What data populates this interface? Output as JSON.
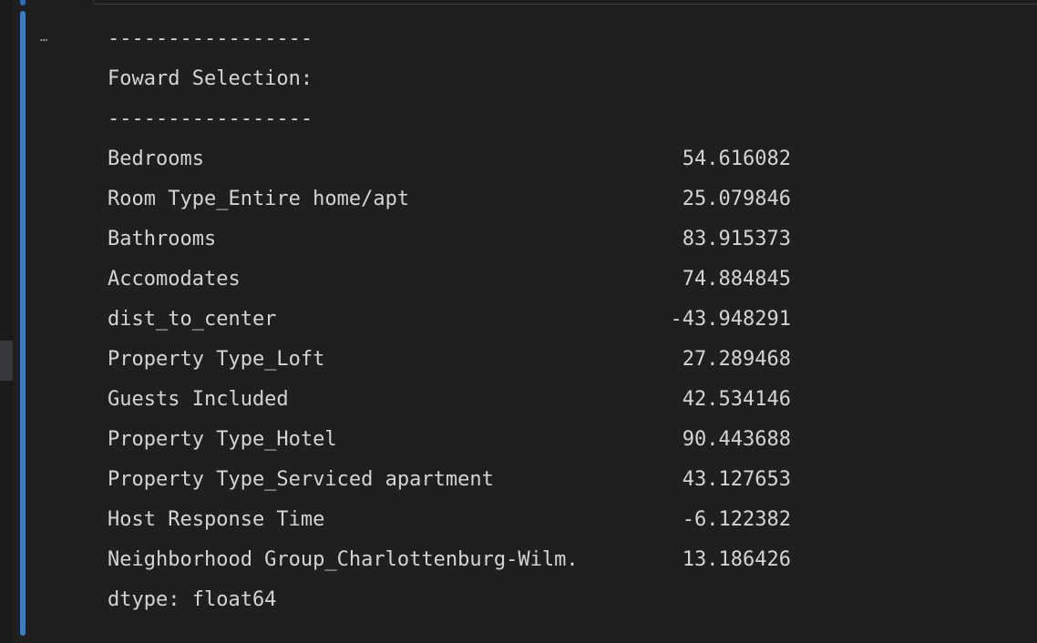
{
  "output": {
    "menu_icon": "…",
    "separator_top": "-----------------",
    "heading": "Foward Selection:",
    "separator_bottom": "-----------------",
    "rows": [
      {
        "name": "Bedrooms",
        "value": "54.616082"
      },
      {
        "name": "Room Type_Entire home/apt",
        "value": "25.079846"
      },
      {
        "name": "Bathrooms",
        "value": "83.915373"
      },
      {
        "name": "Accomodates",
        "value": "74.884845"
      },
      {
        "name": "dist_to_center",
        "value": "-43.948291"
      },
      {
        "name": "Property Type_Loft",
        "value": "27.289468"
      },
      {
        "name": "Guests Included",
        "value": "42.534146"
      },
      {
        "name": "Property Type_Hotel",
        "value": "90.443688"
      },
      {
        "name": "Property Type_Serviced apartment",
        "value": "43.127653"
      },
      {
        "name": "Host Response Time",
        "value": "-6.122382"
      },
      {
        "name": "Neighborhood Group_Charlottenburg-Wilm.",
        "value": "13.186426"
      }
    ],
    "dtype": "dtype: float64"
  },
  "colors": {
    "background": "#1f1f1f",
    "text": "#d4d4d4",
    "execution_bar": "#3b7cc9"
  }
}
